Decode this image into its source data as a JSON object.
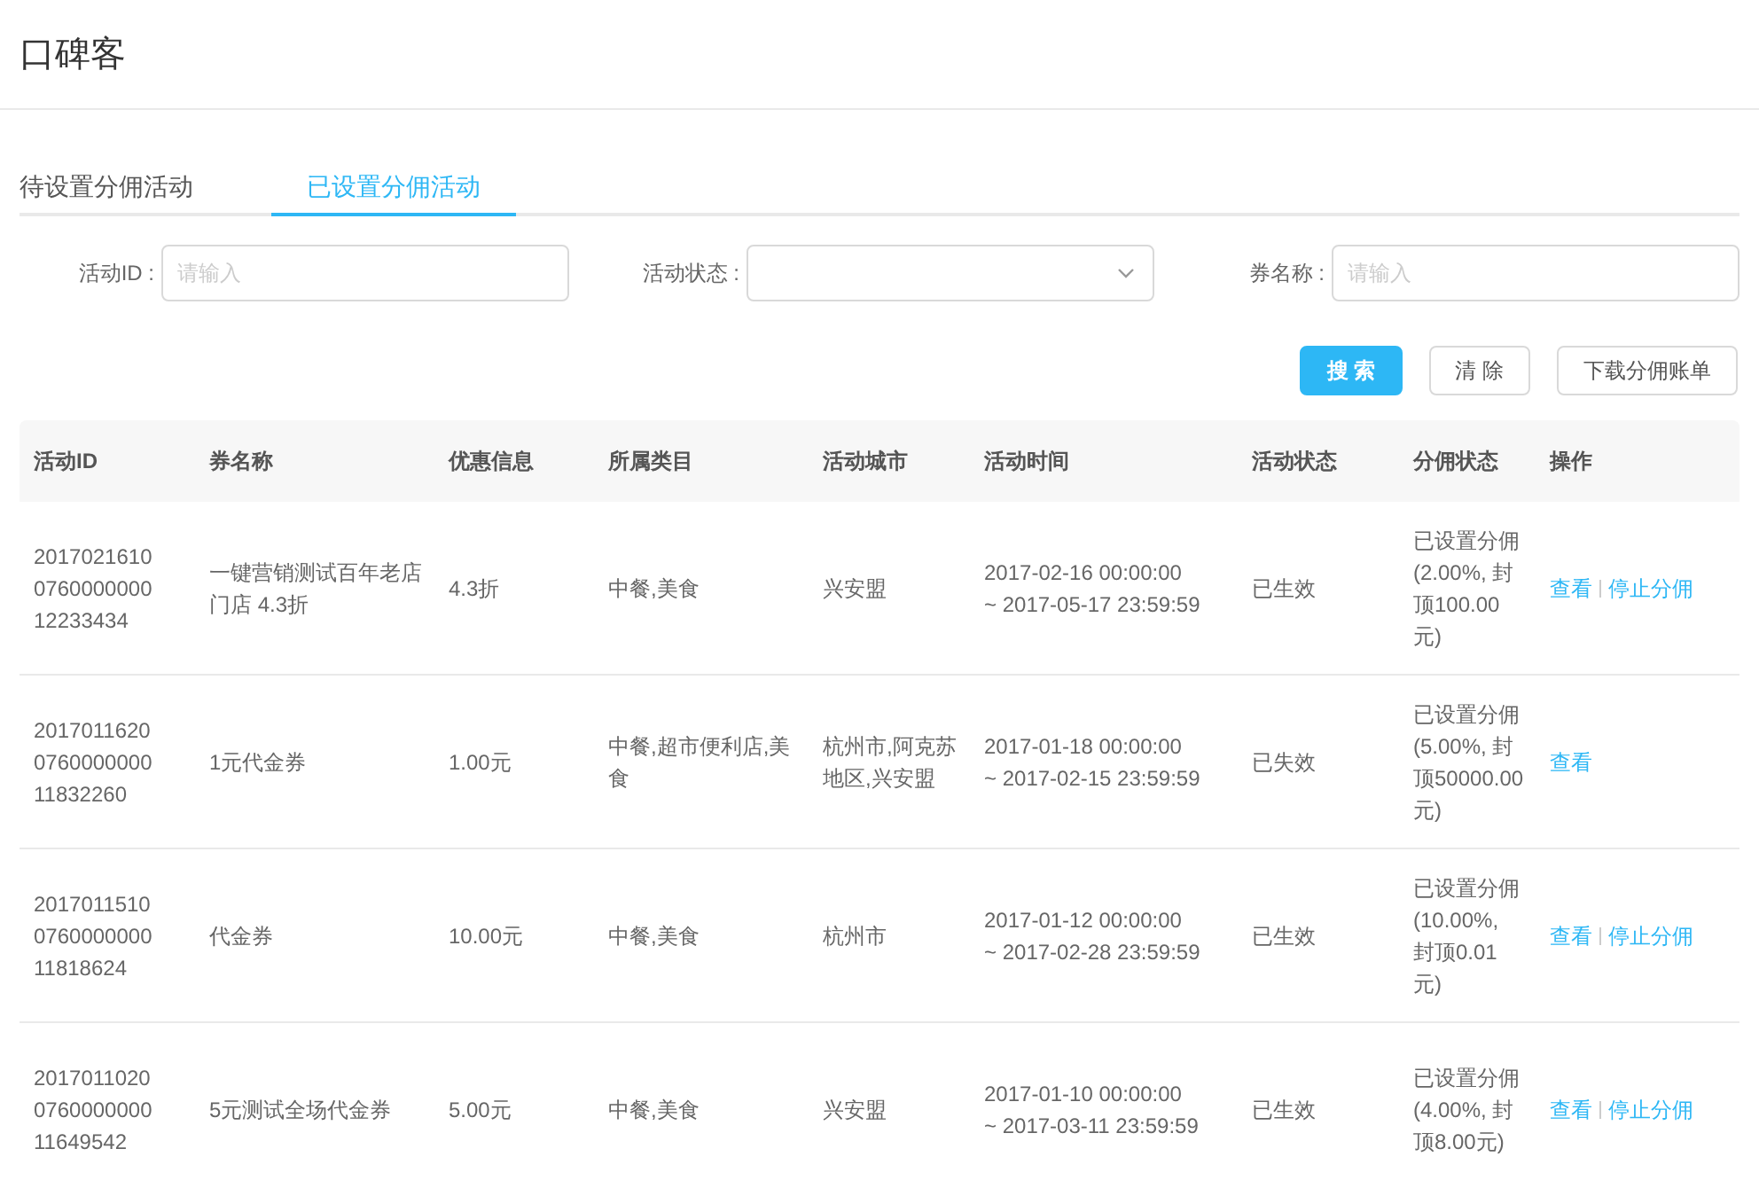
{
  "title": "口碑客",
  "tabs": [
    {
      "label": "待设置分佣活动",
      "selected": false
    },
    {
      "label": "已设置分佣活动",
      "selected": true
    }
  ],
  "filters": [
    {
      "kind": "input",
      "label": "活动ID :",
      "placeholder": "请输入"
    },
    {
      "kind": "select",
      "label": "活动状态 :"
    },
    {
      "kind": "input",
      "label": "券名称 :",
      "placeholder": "请输入"
    }
  ],
  "buttons": [
    {
      "label": "搜 索",
      "primary": true
    },
    {
      "label": "清 除",
      "primary": false
    },
    {
      "label": "下载分佣账单",
      "primary": false
    }
  ],
  "table": {
    "columns": [
      "活动ID",
      "券名称",
      "优惠信息",
      "所属类目",
      "活动城市",
      "活动时间",
      "活动状态",
      "分佣状态",
      "操作"
    ],
    "rows": [
      {
        "cells": [
          "2017021610\n0760000000\n12233434",
          "一键营销测试百年老店门店 4.3折",
          "4.3折",
          "中餐,美食",
          "兴安盟",
          "2017-02-16 00:00:00\n~ 2017-05-17 23:59:59",
          "已生效",
          "已设置分佣(2.00%, 封顶100.00元)"
        ],
        "actions": [
          "查看",
          "停止分佣"
        ]
      },
      {
        "cells": [
          "2017011620\n0760000000\n11832260",
          "1元代金券",
          "1.00元",
          "中餐,超市便利店,美食",
          "杭州市,阿克苏地区,兴安盟",
          "2017-01-18 00:00:00\n~ 2017-02-15 23:59:59",
          "已失效",
          "已设置分佣(5.00%, 封顶50000.00元)"
        ],
        "actions": [
          "查看"
        ]
      },
      {
        "cells": [
          "2017011510\n0760000000\n11818624",
          "代金券",
          "10.00元",
          "中餐,美食",
          "杭州市",
          "2017-01-12 00:00:00\n~ 2017-02-28 23:59:59",
          "已生效",
          "已设置分佣(10.00%, 封顶0.01元)"
        ],
        "actions": [
          "查看",
          "停止分佣"
        ]
      },
      {
        "cells": [
          "2017011020\n0760000000\n11649542",
          "5元测试全场代金券",
          "5.00元",
          "中餐,美食",
          "兴安盟",
          "2017-01-10 00:00:00\n~ 2017-03-11 23:59:59",
          "已生效",
          "已设置分佣(4.00%, 封顶8.00元)"
        ],
        "actions": [
          "查看",
          "停止分佣"
        ]
      }
    ]
  }
}
